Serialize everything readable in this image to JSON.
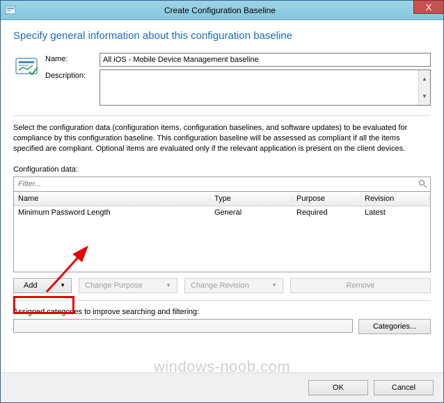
{
  "window": {
    "title": "Create Configuration Baseline",
    "close": "X"
  },
  "heading": "Specify general information about this configuration baseline",
  "form": {
    "name_label": "Name:",
    "name_value": "All iOS - Mobile Device Management baseline",
    "desc_label": "Description:",
    "desc_value": ""
  },
  "help_text": "Select the configuration data (configuration items, configuration baselines, and software updates) to be evaluated for compliance by this configuration baseline. This configuration baseline will be assessed as compliant if all the items specified are compliant. Optional items are evaluated only if the relevant application is present on  the client devices.",
  "config_data": {
    "label": "Configuration data:",
    "filter_placeholder": "Filter...",
    "columns": {
      "name": "Name",
      "type": "Type",
      "purpose": "Purpose",
      "revision": "Revision"
    },
    "rows": [
      {
        "name": "Minimum Password Length",
        "type": "General",
        "purpose": "Required",
        "revision": "Latest"
      }
    ]
  },
  "buttons": {
    "add": "Add",
    "change_purpose": "Change Purpose",
    "change_revision": "Change Revision",
    "remove": "Remove",
    "categories": "Categories...",
    "ok": "OK",
    "cancel": "Cancel"
  },
  "categories_label": "Assigned categories to improve searching and filtering:",
  "watermark": "windows-noob.com"
}
